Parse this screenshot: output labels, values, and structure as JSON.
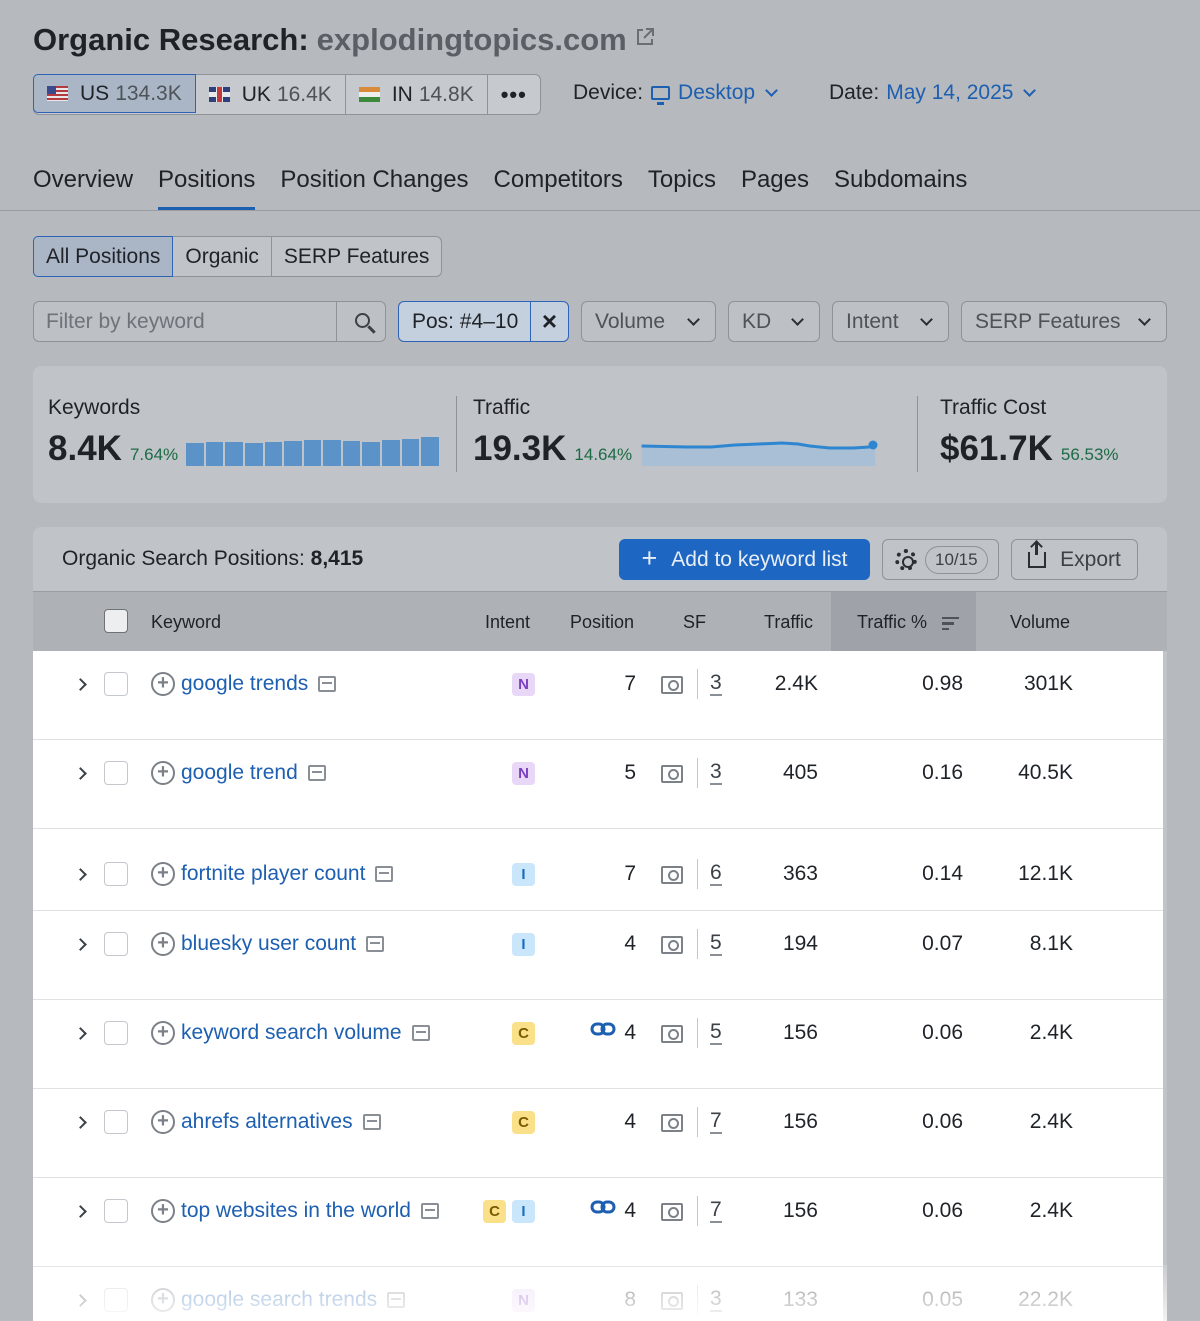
{
  "header": {
    "title_prefix": "Organic Research:",
    "domain": "explodingtopics.com",
    "db_tabs": [
      {
        "code": "US",
        "count": "134.3K"
      },
      {
        "code": "UK",
        "count": "16.4K"
      },
      {
        "code": "IN",
        "count": "14.8K"
      }
    ],
    "more_label": "•••",
    "device_label": "Device:",
    "device_value": "Desktop",
    "date_label": "Date:",
    "date_value": "May 14, 2025"
  },
  "nav": {
    "tabs": [
      "Overview",
      "Positions",
      "Position Changes",
      "Competitors",
      "Topics",
      "Pages",
      "Subdomains"
    ],
    "active": "Positions"
  },
  "sub_tabs": [
    "All Positions",
    "Organic",
    "SERP Features"
  ],
  "filters": {
    "keyword_placeholder": "Filter by keyword",
    "pos_filter": "Pos: #4–10",
    "dropdowns": [
      "Volume",
      "KD",
      "Intent",
      "SERP Features"
    ]
  },
  "summary": {
    "keywords": {
      "label": "Keywords",
      "value": "8.4K",
      "delta": "7.64%"
    },
    "traffic": {
      "label": "Traffic",
      "value": "19.3K",
      "delta": "14.64%"
    },
    "traffic_cost": {
      "label": "Traffic Cost",
      "value": "$61.7K",
      "delta": "56.53%"
    },
    "keywords_trend": [
      0.78,
      0.8,
      0.8,
      0.78,
      0.8,
      0.82,
      0.85,
      0.88,
      0.82,
      0.8,
      0.85,
      0.9,
      0.95
    ]
  },
  "table": {
    "title_label": "Organic Search Positions:",
    "title_count": "8,415",
    "add_button": "Add to keyword list",
    "columns_badge": "10/15",
    "export_button": "Export",
    "headers": {
      "keyword": "Keyword",
      "intent": "Intent",
      "position": "Position",
      "sf": "SF",
      "traffic": "Traffic",
      "traffic_pct": "Traffic %",
      "volume": "Volume"
    },
    "rows": [
      {
        "keyword": "google trends",
        "intents": [
          "N"
        ],
        "linked": false,
        "position": "7",
        "sf": "3",
        "traffic": "2.4K",
        "traffic_pct": "0.98",
        "volume": "301K"
      },
      {
        "keyword": "google trend",
        "intents": [
          "N"
        ],
        "linked": false,
        "position": "5",
        "sf": "3",
        "traffic": "405",
        "traffic_pct": "0.16",
        "volume": "40.5K"
      },
      {
        "keyword": "fortnite player count",
        "intents": [
          "I"
        ],
        "linked": false,
        "position": "7",
        "sf": "6",
        "traffic": "363",
        "traffic_pct": "0.14",
        "volume": "12.1K"
      },
      {
        "keyword": "bluesky user count",
        "intents": [
          "I"
        ],
        "linked": false,
        "position": "4",
        "sf": "5",
        "traffic": "194",
        "traffic_pct": "0.07",
        "volume": "8.1K"
      },
      {
        "keyword": "keyword search volume",
        "intents": [
          "C"
        ],
        "linked": true,
        "position": "4",
        "sf": "5",
        "traffic": "156",
        "traffic_pct": "0.06",
        "volume": "2.4K"
      },
      {
        "keyword": "ahrefs alternatives",
        "intents": [
          "C"
        ],
        "linked": false,
        "position": "4",
        "sf": "7",
        "traffic": "156",
        "traffic_pct": "0.06",
        "volume": "2.4K"
      },
      {
        "keyword": "top websites in the world",
        "intents": [
          "C",
          "I"
        ],
        "linked": true,
        "position": "4",
        "sf": "7",
        "traffic": "156",
        "traffic_pct": "0.06",
        "volume": "2.4K"
      },
      {
        "keyword": "google search trends",
        "intents": [
          "N"
        ],
        "linked": false,
        "position": "8",
        "sf": "3",
        "traffic": "133",
        "traffic_pct": "0.05",
        "volume": "22.2K"
      }
    ]
  },
  "icons": {
    "external_link": "external-link-icon",
    "link": "link-icon",
    "serp": "serp-snapshot-icon"
  },
  "colors": {
    "accent": "#1d66c2",
    "link": "#1d5fb0",
    "positive": "#1c6b45"
  }
}
